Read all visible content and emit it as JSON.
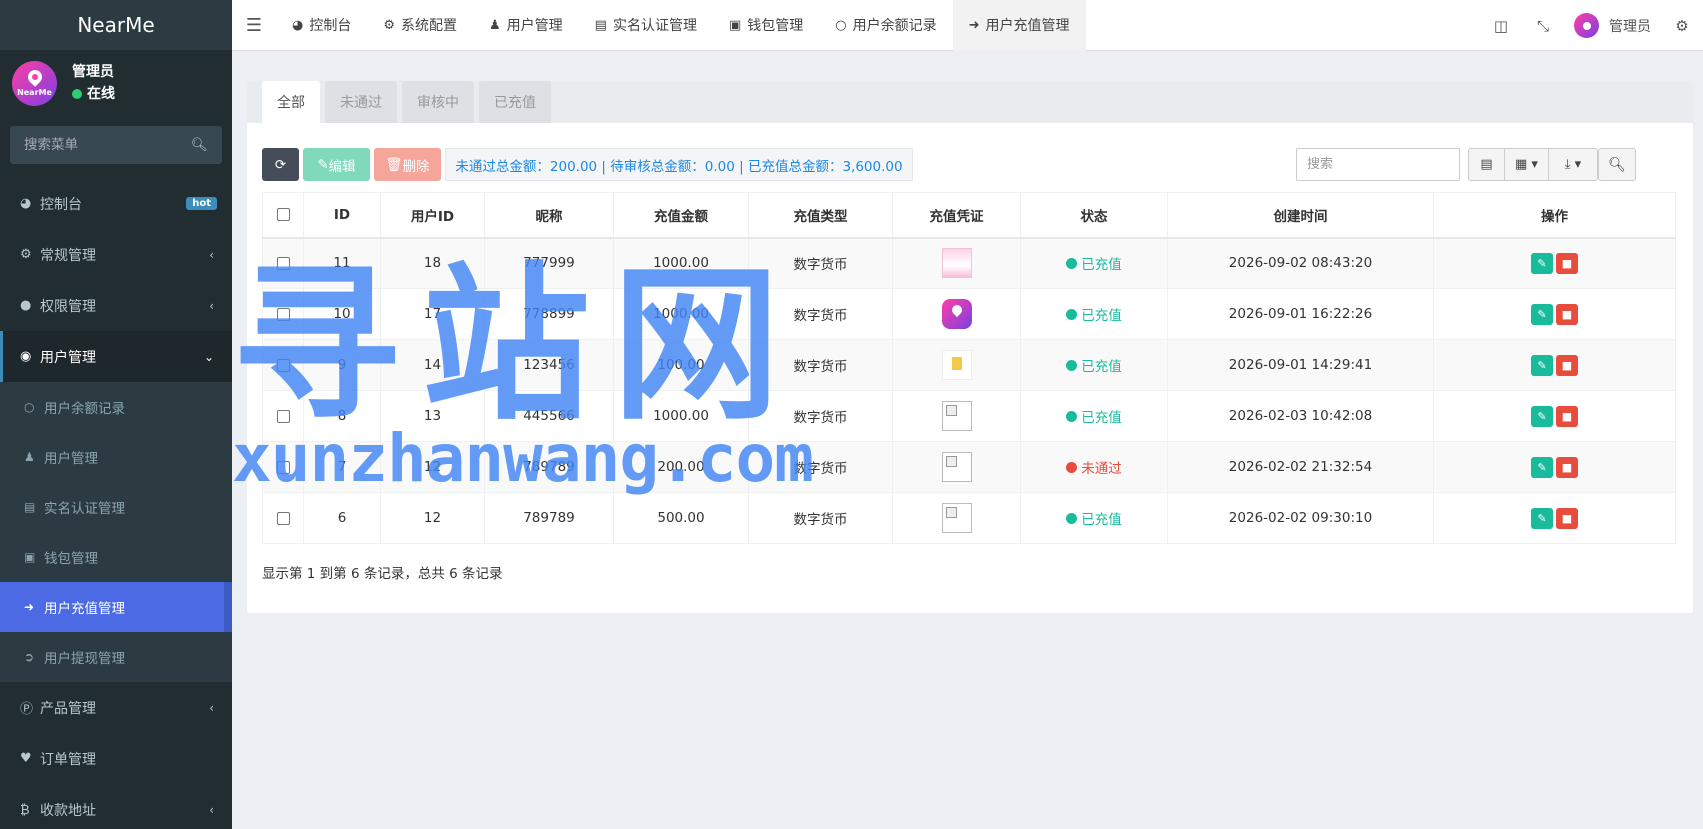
{
  "brand": "NearMe",
  "user": {
    "name": "管理员",
    "status": "在线",
    "avatar_text": "NearMe"
  },
  "side_search": {
    "placeholder": "搜索菜单"
  },
  "menu": {
    "dashboard": "控制台",
    "hot": "hot",
    "general": "常规管理",
    "permission": "权限管理",
    "users": "用户管理",
    "sub": [
      "用户余额记录",
      "用户管理",
      "实名认证管理",
      "钱包管理",
      "用户充值管理",
      "用户提现管理"
    ],
    "product": "产品管理",
    "orders": "订单管理",
    "address": "收款地址"
  },
  "topbar": {
    "tabs": [
      "控制台",
      "系统配置",
      "用户管理",
      "实名认证管理",
      "钱包管理",
      "用户余额记录",
      "用户充值管理"
    ],
    "admin": "管理员"
  },
  "panel_tabs": [
    "全部",
    "未通过",
    "审核中",
    "已充值"
  ],
  "toolbar": {
    "edit": "编辑",
    "delete": "删除",
    "summary": "未通过总金额：200.00 | 待审核总金额：0.00 | 已充值总金额：3,600.00",
    "search_placeholder": "搜索"
  },
  "table": {
    "headers": [
      "ID",
      "用户ID",
      "昵称",
      "充值金额",
      "充值类型",
      "充值凭证",
      "状态",
      "创建时间",
      "操作"
    ],
    "rows": [
      {
        "id": "11",
        "uid": "18",
        "nick": "777999",
        "amount": "1000.00",
        "type": "数字货币",
        "status": "已充值",
        "time": "2026-09-02 08:43:20"
      },
      {
        "id": "10",
        "uid": "17",
        "nick": "778899",
        "amount": "1000.00",
        "type": "数字货币",
        "status": "已充值",
        "time": "2026-09-01 16:22:26"
      },
      {
        "id": "9",
        "uid": "14",
        "nick": "123456",
        "amount": "100.00",
        "type": "数字货币",
        "status": "已充值",
        "time": "2026-09-01 14:29:41"
      },
      {
        "id": "8",
        "uid": "13",
        "nick": "445566",
        "amount": "1000.00",
        "type": "数字货币",
        "status": "已充值",
        "time": "2026-02-03 10:42:08"
      },
      {
        "id": "7",
        "uid": "12",
        "nick": "789789",
        "amount": "200.00",
        "type": "数字货币",
        "status": "未通过",
        "time": "2026-02-02 21:32:54"
      },
      {
        "id": "6",
        "uid": "12",
        "nick": "789789",
        "amount": "500.00",
        "type": "数字货币",
        "status": "已充值",
        "time": "2026-02-02 09:30:10"
      }
    ]
  },
  "pager": "显示第 1 到第 6 条记录，总共 6 条记录",
  "watermark": {
    "line1": "寻站网",
    "line2": "xunzhanwang.com"
  },
  "colors": {
    "sidebar": "#222d32",
    "active": "#4c6ae3",
    "success": "#18bc9c",
    "danger": "#e74c3c",
    "summary_text": "#1e88e5"
  }
}
